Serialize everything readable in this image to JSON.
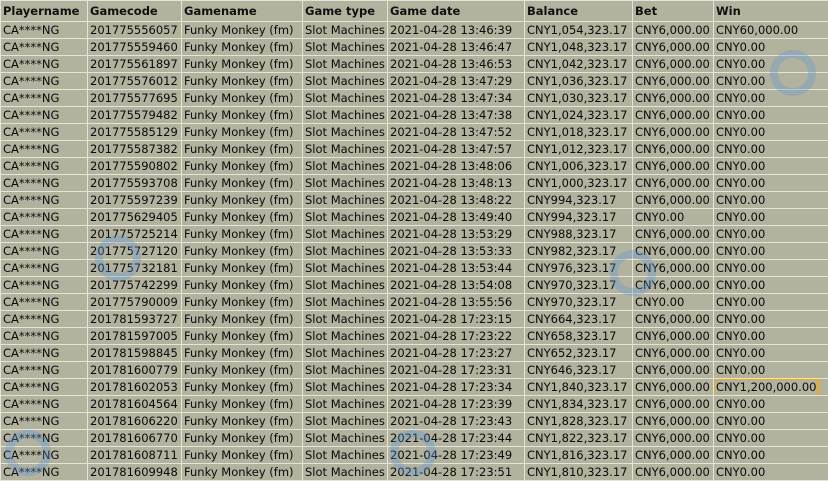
{
  "table": {
    "columns": [
      "Playername",
      "Gamecode",
      "Gamename",
      "Game type",
      "Game date",
      "Balance",
      "Bet",
      "Win"
    ],
    "rows": [
      [
        "CA****NG",
        "201775556057",
        "Funky Monkey (fm)",
        "Slot Machines",
        "2021-04-28 13:46:39",
        "CNY1,054,323.17",
        "CNY6,000.00",
        "CNY60,000.00"
      ],
      [
        "CA****NG",
        "201775559460",
        "Funky Monkey (fm)",
        "Slot Machines",
        "2021-04-28 13:46:47",
        "CNY1,048,323.17",
        "CNY6,000.00",
        "CNY0.00"
      ],
      [
        "CA****NG",
        "201775561897",
        "Funky Monkey (fm)",
        "Slot Machines",
        "2021-04-28 13:46:53",
        "CNY1,042,323.17",
        "CNY6,000.00",
        "CNY0.00"
      ],
      [
        "CA****NG",
        "201775576012",
        "Funky Monkey (fm)",
        "Slot Machines",
        "2021-04-28 13:47:29",
        "CNY1,036,323.17",
        "CNY6,000.00",
        "CNY0.00"
      ],
      [
        "CA****NG",
        "201775577695",
        "Funky Monkey (fm)",
        "Slot Machines",
        "2021-04-28 13:47:34",
        "CNY1,030,323.17",
        "CNY6,000.00",
        "CNY0.00"
      ],
      [
        "CA****NG",
        "201775579482",
        "Funky Monkey (fm)",
        "Slot Machines",
        "2021-04-28 13:47:38",
        "CNY1,024,323.17",
        "CNY6,000.00",
        "CNY0.00"
      ],
      [
        "CA****NG",
        "201775585129",
        "Funky Monkey (fm)",
        "Slot Machines",
        "2021-04-28 13:47:52",
        "CNY1,018,323.17",
        "CNY6,000.00",
        "CNY0.00"
      ],
      [
        "CA****NG",
        "201775587382",
        "Funky Monkey (fm)",
        "Slot Machines",
        "2021-04-28 13:47:57",
        "CNY1,012,323.17",
        "CNY6,000.00",
        "CNY0.00"
      ],
      [
        "CA****NG",
        "201775590802",
        "Funky Monkey (fm)",
        "Slot Machines",
        "2021-04-28 13:48:06",
        "CNY1,006,323.17",
        "CNY6,000.00",
        "CNY0.00"
      ],
      [
        "CA****NG",
        "201775593708",
        "Funky Monkey (fm)",
        "Slot Machines",
        "2021-04-28 13:48:13",
        "CNY1,000,323.17",
        "CNY6,000.00",
        "CNY0.00"
      ],
      [
        "CA****NG",
        "201775597239",
        "Funky Monkey (fm)",
        "Slot Machines",
        "2021-04-28 13:48:22",
        "CNY994,323.17",
        "CNY6,000.00",
        "CNY0.00"
      ],
      [
        "CA****NG",
        "201775629405",
        "Funky Monkey (fm)",
        "Slot Machines",
        "2021-04-28 13:49:40",
        "CNY994,323.17",
        "CNY0.00",
        "CNY0.00"
      ],
      [
        "CA****NG",
        "201775725214",
        "Funky Monkey (fm)",
        "Slot Machines",
        "2021-04-28 13:53:29",
        "CNY988,323.17",
        "CNY6,000.00",
        "CNY0.00"
      ],
      [
        "CA****NG",
        "201775727120",
        "Funky Monkey (fm)",
        "Slot Machines",
        "2021-04-28 13:53:33",
        "CNY982,323.17",
        "CNY6,000.00",
        "CNY0.00"
      ],
      [
        "CA****NG",
        "201775732181",
        "Funky Monkey (fm)",
        "Slot Machines",
        "2021-04-28 13:53:44",
        "CNY976,323.17",
        "CNY6,000.00",
        "CNY0.00"
      ],
      [
        "CA****NG",
        "201775742299",
        "Funky Monkey (fm)",
        "Slot Machines",
        "2021-04-28 13:54:08",
        "CNY970,323.17",
        "CNY6,000.00",
        "CNY0.00"
      ],
      [
        "CA****NG",
        "201775790009",
        "Funky Monkey (fm)",
        "Slot Machines",
        "2021-04-28 13:55:56",
        "CNY970,323.17",
        "CNY0.00",
        "CNY0.00"
      ],
      [
        "CA****NG",
        "201781593727",
        "Funky Monkey (fm)",
        "Slot Machines",
        "2021-04-28 17:23:15",
        "CNY664,323.17",
        "CNY6,000.00",
        "CNY0.00"
      ],
      [
        "CA****NG",
        "201781597005",
        "Funky Monkey (fm)",
        "Slot Machines",
        "2021-04-28 17:23:22",
        "CNY658,323.17",
        "CNY6,000.00",
        "CNY0.00"
      ],
      [
        "CA****NG",
        "201781598845",
        "Funky Monkey (fm)",
        "Slot Machines",
        "2021-04-28 17:23:27",
        "CNY652,323.17",
        "CNY6,000.00",
        "CNY0.00"
      ],
      [
        "CA****NG",
        "201781600779",
        "Funky Monkey (fm)",
        "Slot Machines",
        "2021-04-28 17:23:31",
        "CNY646,323.17",
        "CNY6,000.00",
        "CNY0.00"
      ],
      [
        "CA****NG",
        "201781602053",
        "Funky Monkey (fm)",
        "Slot Machines",
        "2021-04-28 17:23:34",
        "CNY1,840,323.17",
        "CNY6,000.00",
        "CNY1,200,000.00"
      ],
      [
        "CA****NG",
        "201781604564",
        "Funky Monkey (fm)",
        "Slot Machines",
        "2021-04-28 17:23:39",
        "CNY1,834,323.17",
        "CNY6,000.00",
        "CNY0.00"
      ],
      [
        "CA****NG",
        "201781606220",
        "Funky Monkey (fm)",
        "Slot Machines",
        "2021-04-28 17:23:43",
        "CNY1,828,323.17",
        "CNY6,000.00",
        "CNY0.00"
      ],
      [
        "CA****NG",
        "201781606770",
        "Funky Monkey (fm)",
        "Slot Machines",
        "2021-04-28 17:23:44",
        "CNY1,822,323.17",
        "CNY6,000.00",
        "CNY0.00"
      ],
      [
        "CA****NG",
        "201781608711",
        "Funky Monkey (fm)",
        "Slot Machines",
        "2021-04-28 17:23:49",
        "CNY1,816,323.17",
        "CNY6,000.00",
        "CNY0.00"
      ],
      [
        "CA****NG",
        "201781609948",
        "Funky Monkey (fm)",
        "Slot Machines",
        "2021-04-28 17:23:51",
        "CNY1,810,323.17",
        "CNY6,000.00",
        "CNY0.00"
      ]
    ],
    "highlighted_row": 21,
    "highlighted_column": 7
  },
  "colors": {
    "background": "#b3b29e",
    "grid_lines": "#e4e4d8",
    "highlight_outline": "#e8b010",
    "watermark": "#5b95d6"
  },
  "watermark_icon": "circle-logo-watermark"
}
